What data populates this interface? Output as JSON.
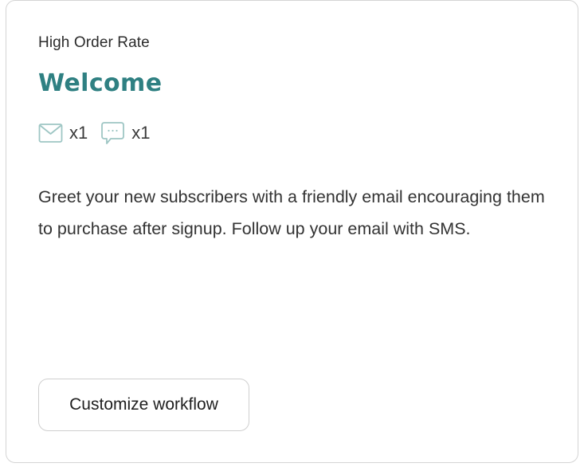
{
  "card": {
    "eyebrow": "High Order Rate",
    "title": "Welcome",
    "channels": [
      {
        "icon": "envelope-icon",
        "count": "x1"
      },
      {
        "icon": "chat-bubble-icon",
        "count": "x1"
      }
    ],
    "description": "Greet your new subscribers with a friendly email encouraging them to purchase after signup. Follow up your email with SMS.",
    "cta_label": "Customize workflow"
  },
  "colors": {
    "title": "#2f8082",
    "icon_stroke": "#9ec6c4",
    "border": "#d4d4d4"
  }
}
